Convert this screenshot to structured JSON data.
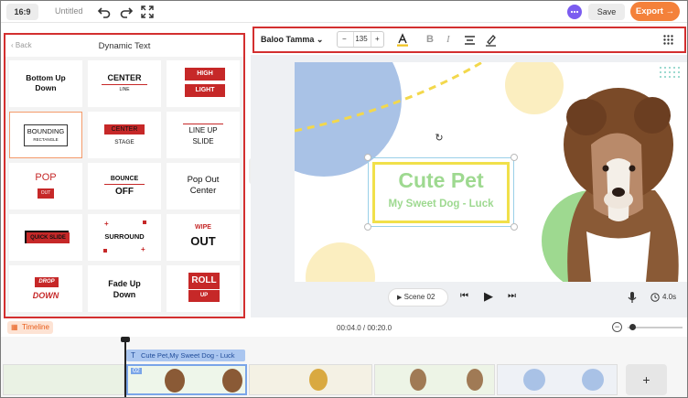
{
  "topbar": {
    "aspect_ratio": "16:9",
    "project_name": "Untitled",
    "undo_icon": "undo-icon",
    "redo_icon": "redo-icon",
    "fullscreen_icon": "fullscreen-icon",
    "chat_icon": "chat-icon",
    "save_label": "Save",
    "export_label": "Export"
  },
  "left_panel": {
    "back_label": "Back",
    "title": "Dynamic Text",
    "tiles": [
      {
        "lines": [
          "Bottom Up",
          "Down"
        ]
      },
      {
        "lines": [
          "CENTER",
          "LINE"
        ]
      },
      {
        "lines": [
          "HIGH",
          "LIGHT"
        ]
      },
      {
        "lines": [
          "BOUNDING",
          "RECTANGLE"
        ]
      },
      {
        "lines": [
          "CENTER",
          "STAGE"
        ]
      },
      {
        "lines": [
          "LINE UP",
          "SLIDE"
        ]
      },
      {
        "lines": [
          "POP",
          "OUT"
        ]
      },
      {
        "lines": [
          "BOUNCE",
          "OFF"
        ]
      },
      {
        "lines": [
          "Pop Out",
          "Center"
        ]
      },
      {
        "lines": [
          "QUICK SLIDE"
        ]
      },
      {
        "lines": [
          "SURROUND"
        ]
      },
      {
        "lines": [
          "WIPE",
          "OUT"
        ]
      },
      {
        "lines": [
          "DROP",
          "DOWN"
        ]
      },
      {
        "lines": [
          "Fade Up",
          "Down"
        ]
      },
      {
        "lines": [
          "ROLL",
          "UP"
        ]
      }
    ]
  },
  "toolbar": {
    "font_name": "Baloo Tamma",
    "font_size": "135",
    "minus": "−",
    "plus": "+",
    "grid_icon": "grid-icon"
  },
  "slide": {
    "title": "Cute Pet",
    "subtitle": "My Sweet Dog - Luck"
  },
  "playback": {
    "scene_label": "Scene 02",
    "duration": "4.0s"
  },
  "timeline": {
    "label": "Timeline",
    "timecode": "00:04.0 / 00:20.0",
    "clip_label": "Cute Pet,My Sweet Dog - Luck",
    "scene_number": "02",
    "add_label": "+"
  },
  "colors": {
    "accent": "#f4813a",
    "highlight_border": "#d32f2f",
    "title_green": "#9ed990",
    "text_box_yellow": "#f1e04a",
    "clip_blue": "#aac6f0"
  }
}
